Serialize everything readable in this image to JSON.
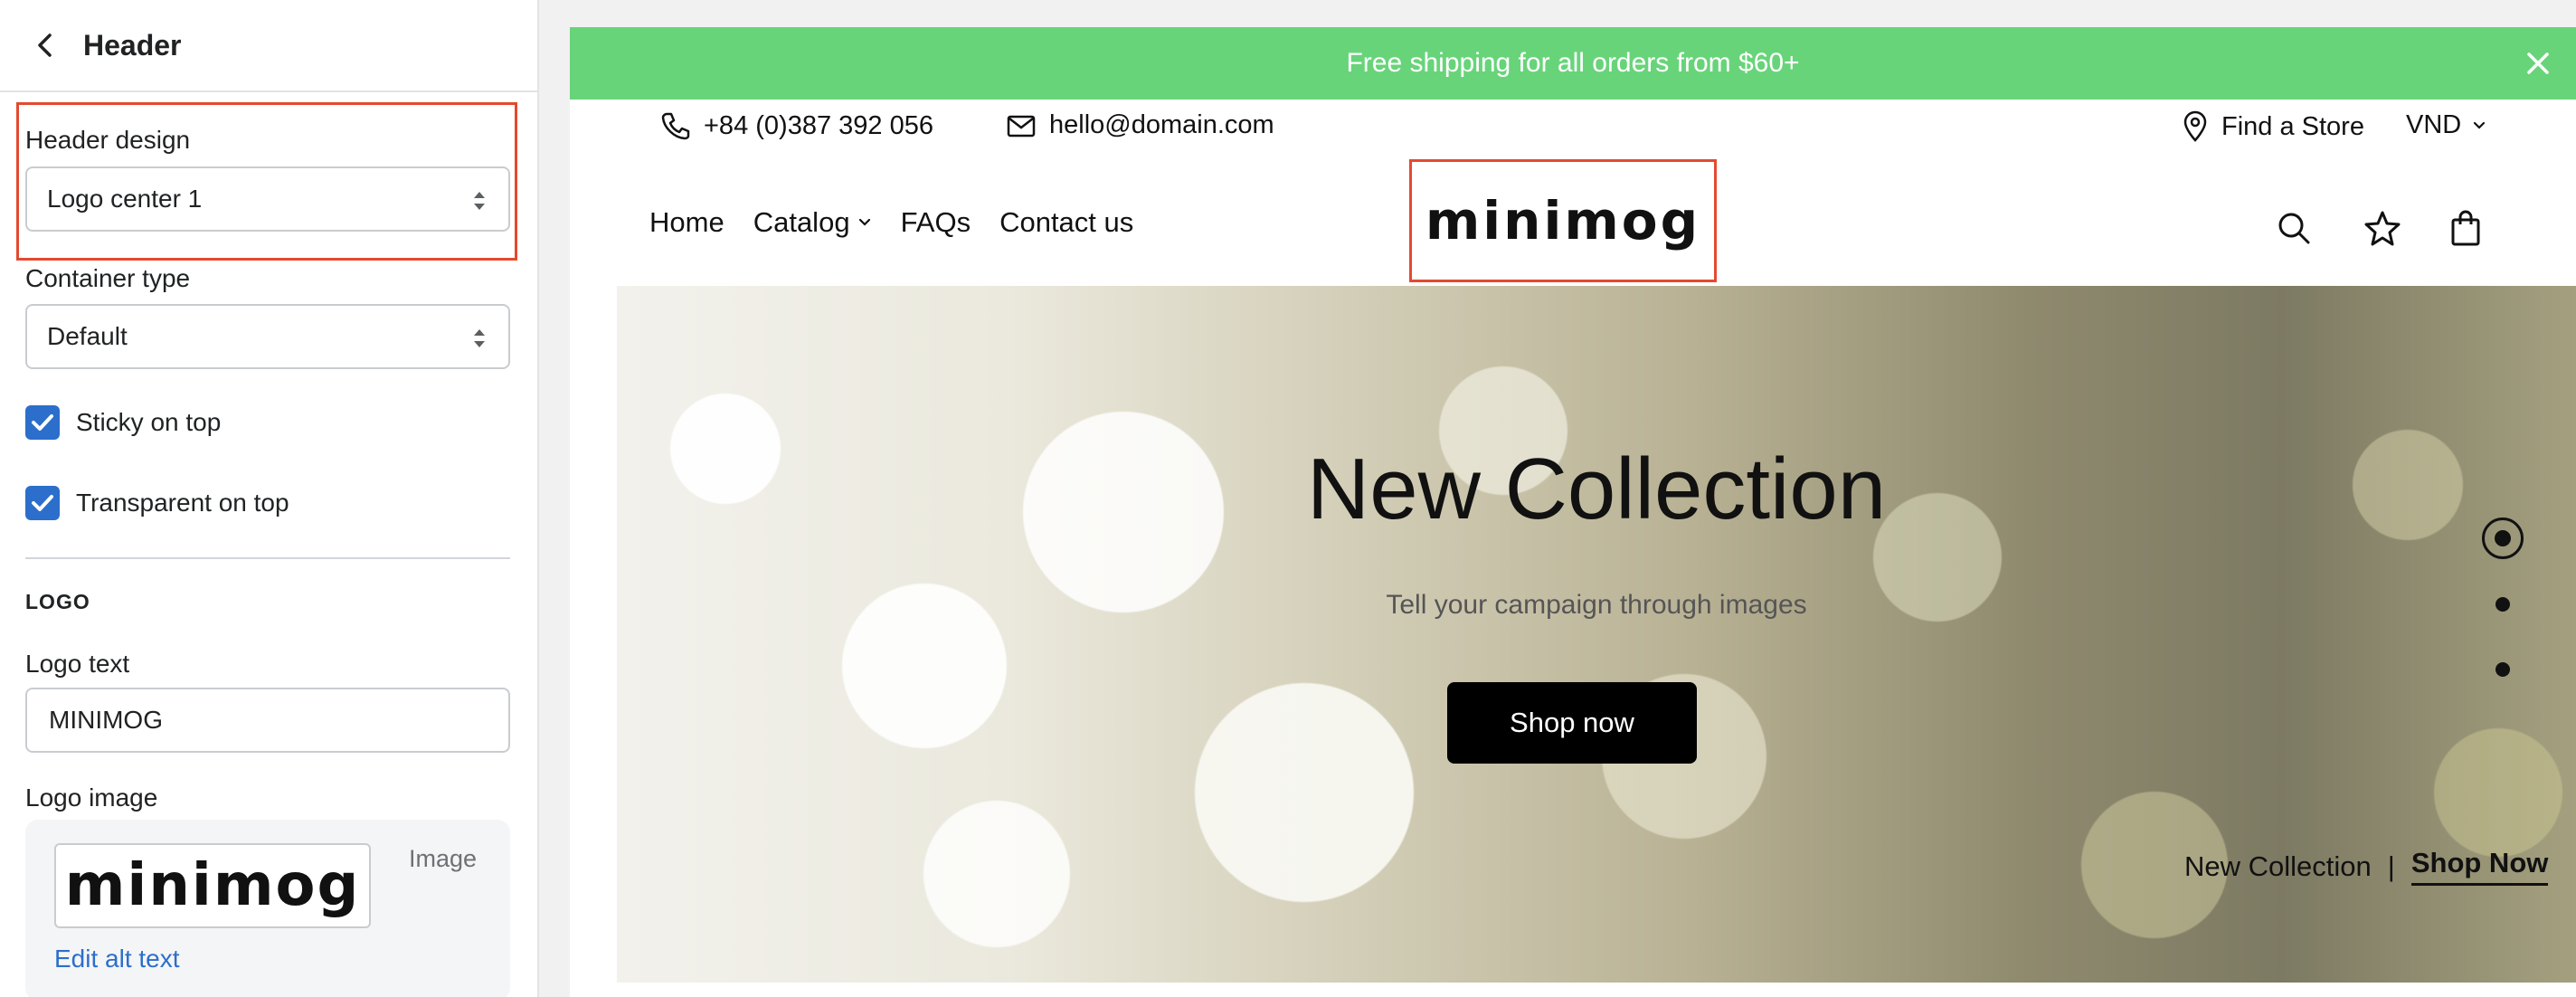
{
  "panel": {
    "title": "Header",
    "header_design": {
      "label": "Header design",
      "value": "Logo center 1"
    },
    "container_type": {
      "label": "Container type",
      "value": "Default"
    },
    "sticky": {
      "label": "Sticky on top",
      "checked": true
    },
    "transparent": {
      "label": "Transparent on top",
      "checked": true
    },
    "logo_section": "LOGO",
    "logo_text": {
      "label": "Logo text",
      "value": "MINIMOG"
    },
    "logo_image": {
      "label": "Logo image",
      "preview_text": "minimog",
      "type_label": "Image",
      "edit_alt": "Edit alt text"
    }
  },
  "preview": {
    "announcement": "Free shipping for all orders from $60+",
    "phone": "+84 (0)387 392 056",
    "email": "hello@domain.com",
    "find_store": "Find a Store",
    "currency": "VND",
    "nav": [
      "Home",
      "Catalog",
      "FAQs",
      "Contact us"
    ],
    "logo": "minimog",
    "hero": {
      "title": "New Collection",
      "subtitle": "Tell your campaign through images",
      "button": "Shop now",
      "caption": "New Collection",
      "caption_sep": "|",
      "caption_link": "Shop Now"
    }
  },
  "colors": {
    "announcement_bg": "#68d47a",
    "highlight": "#e34a2f",
    "checkbox": "#2c6ecb",
    "link": "#2c6ecb"
  }
}
